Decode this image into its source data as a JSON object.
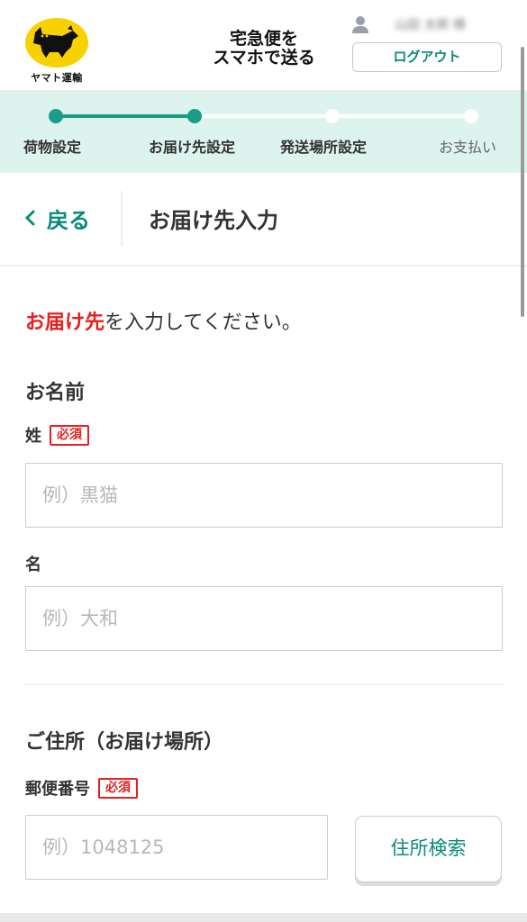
{
  "header": {
    "logo_text": "ヤマト運輸",
    "service_title_line1": "宅急便を",
    "service_title_line2": "スマホで送る",
    "user_name": "山田 太郎 様",
    "logout_label": "ログアウト"
  },
  "stepper": {
    "steps": [
      {
        "label": "荷物設定",
        "state": "done"
      },
      {
        "label": "お届け先設定",
        "state": "current"
      },
      {
        "label": "発送場所設定",
        "state": "todo"
      },
      {
        "label": "お支払い",
        "state": "todo"
      }
    ]
  },
  "backbar": {
    "back_label": "戻る",
    "title": "お届け先入力"
  },
  "form": {
    "intro_highlight": "お届け先",
    "intro_rest": "を入力してください。",
    "name_section": {
      "title": "お名前",
      "last_name_label": "姓",
      "last_name_required": "必須",
      "last_name_placeholder": "例）黒猫",
      "first_name_label": "名",
      "first_name_placeholder": "例）大和"
    },
    "address_section": {
      "title": "ご住所（お届け場所）",
      "postal_label": "郵便番号",
      "postal_required": "必須",
      "postal_placeholder": "例）1048125",
      "search_button_label": "住所検索"
    }
  },
  "colors": {
    "accent": "#0a8a7a",
    "stepper_bg": "#dcf3ee",
    "required_red": "#e5201f",
    "logo_yellow": "#f7d100"
  },
  "icons": [
    "black-cat-logo-icon",
    "user-icon",
    "chevron-left-icon"
  ]
}
